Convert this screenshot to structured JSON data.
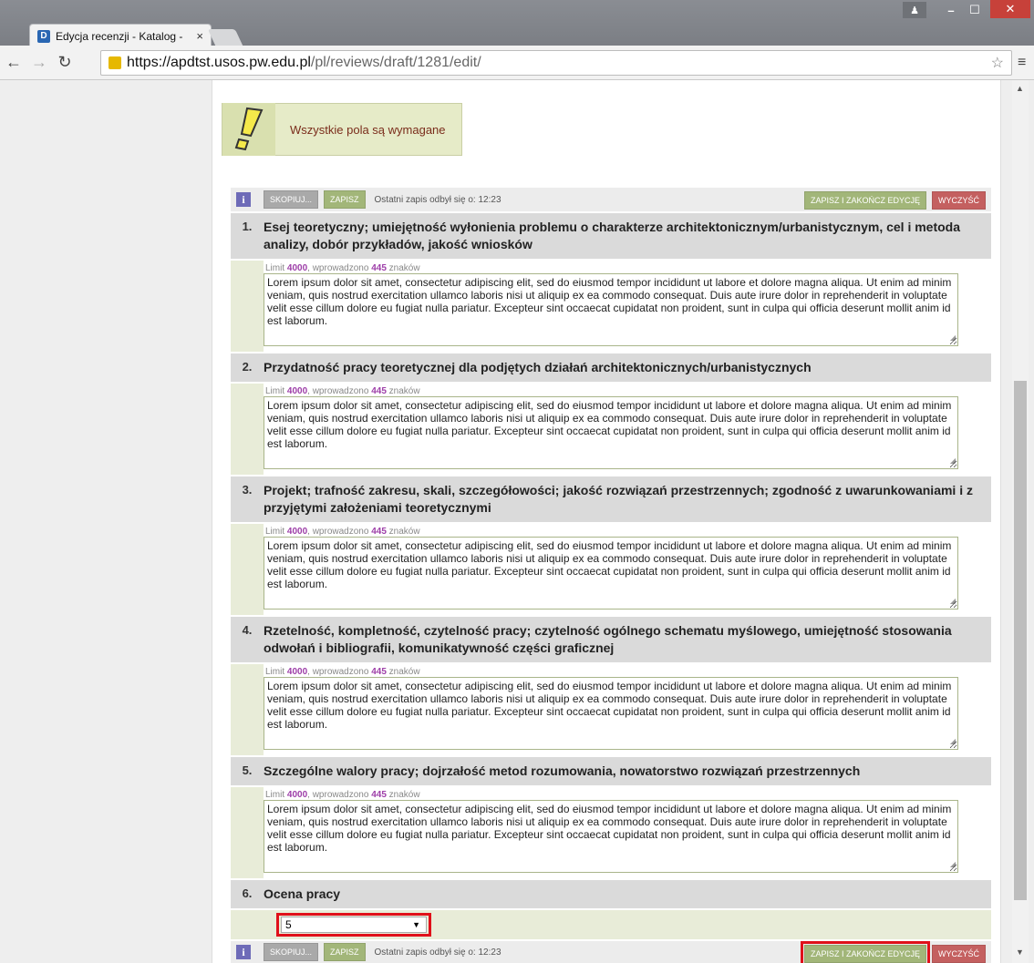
{
  "browser": {
    "tab_title": "Edycja recenzji - Katalog -",
    "tab_favicon": "D",
    "tab_close": "×",
    "url_host": "https://apdtst.usos.pw.edu.pl",
    "url_path": "/pl/reviews/draft/1281/edit/"
  },
  "notice": {
    "text": "Wszystkie pola są wymagane"
  },
  "toolbar": {
    "copy_label": "SKOPIUJ...",
    "save_label": "ZAPISZ",
    "last_save": "Ostatni zapis odbył się o: 12:23",
    "save_finish_label": "ZAPISZ I ZAKOŃCZ EDYCJĘ",
    "clear_label": "WYCZYŚĆ"
  },
  "limit": {
    "prefix": "Limit",
    "max": "4000",
    "mid": ", wprowadzono",
    "count": "445",
    "suffix": "znaków"
  },
  "criteria": [
    {
      "num": "1.",
      "title": "Esej teoretyczny; umiejętność wyłonienia problemu o charakterze architektonicznym/urbanistycznym, cel i metoda analizy, dobór przykładów, jakość wniosków"
    },
    {
      "num": "2.",
      "title": "Przydatność pracy teoretycznej dla podjętych działań architektonicznych/urbanistycznych"
    },
    {
      "num": "3.",
      "title": "Projekt; trafność zakresu, skali, szczegółowości; jakość rozwiązań przestrzennych; zgodność z uwarunkowaniami i z przyjętymi założeniami teoretycznymi"
    },
    {
      "num": "4.",
      "title": "Rzetelność, kompletność, czytelność pracy; czytelność ogólnego schematu myślowego, umiejętność stosowania odwołań i bibliografii, komunikatywność części graficznej"
    },
    {
      "num": "5.",
      "title": "Szczególne walory pracy; dojrzałość metod rozumowania, nowatorstwo rozwiązań przestrzennych"
    },
    {
      "num": "6.",
      "title": "Ocena pracy"
    }
  ],
  "textarea_value": "Lorem ipsum dolor sit amet, consectetur adipiscing elit, sed do eiusmod tempor incididunt ut labore et dolore magna aliqua. Ut enim ad minim veniam, quis nostrud exercitation ullamco laboris nisi ut aliquip ex ea commodo consequat. Duis aute irure dolor in reprehenderit in voluptate velit esse cillum dolore eu fugiat nulla pariatur. Excepteur sint occaecat cupidatat non proident, sunt in culpa qui officia deserunt mollit anim id est laborum.",
  "grade_select": {
    "value": "5"
  }
}
